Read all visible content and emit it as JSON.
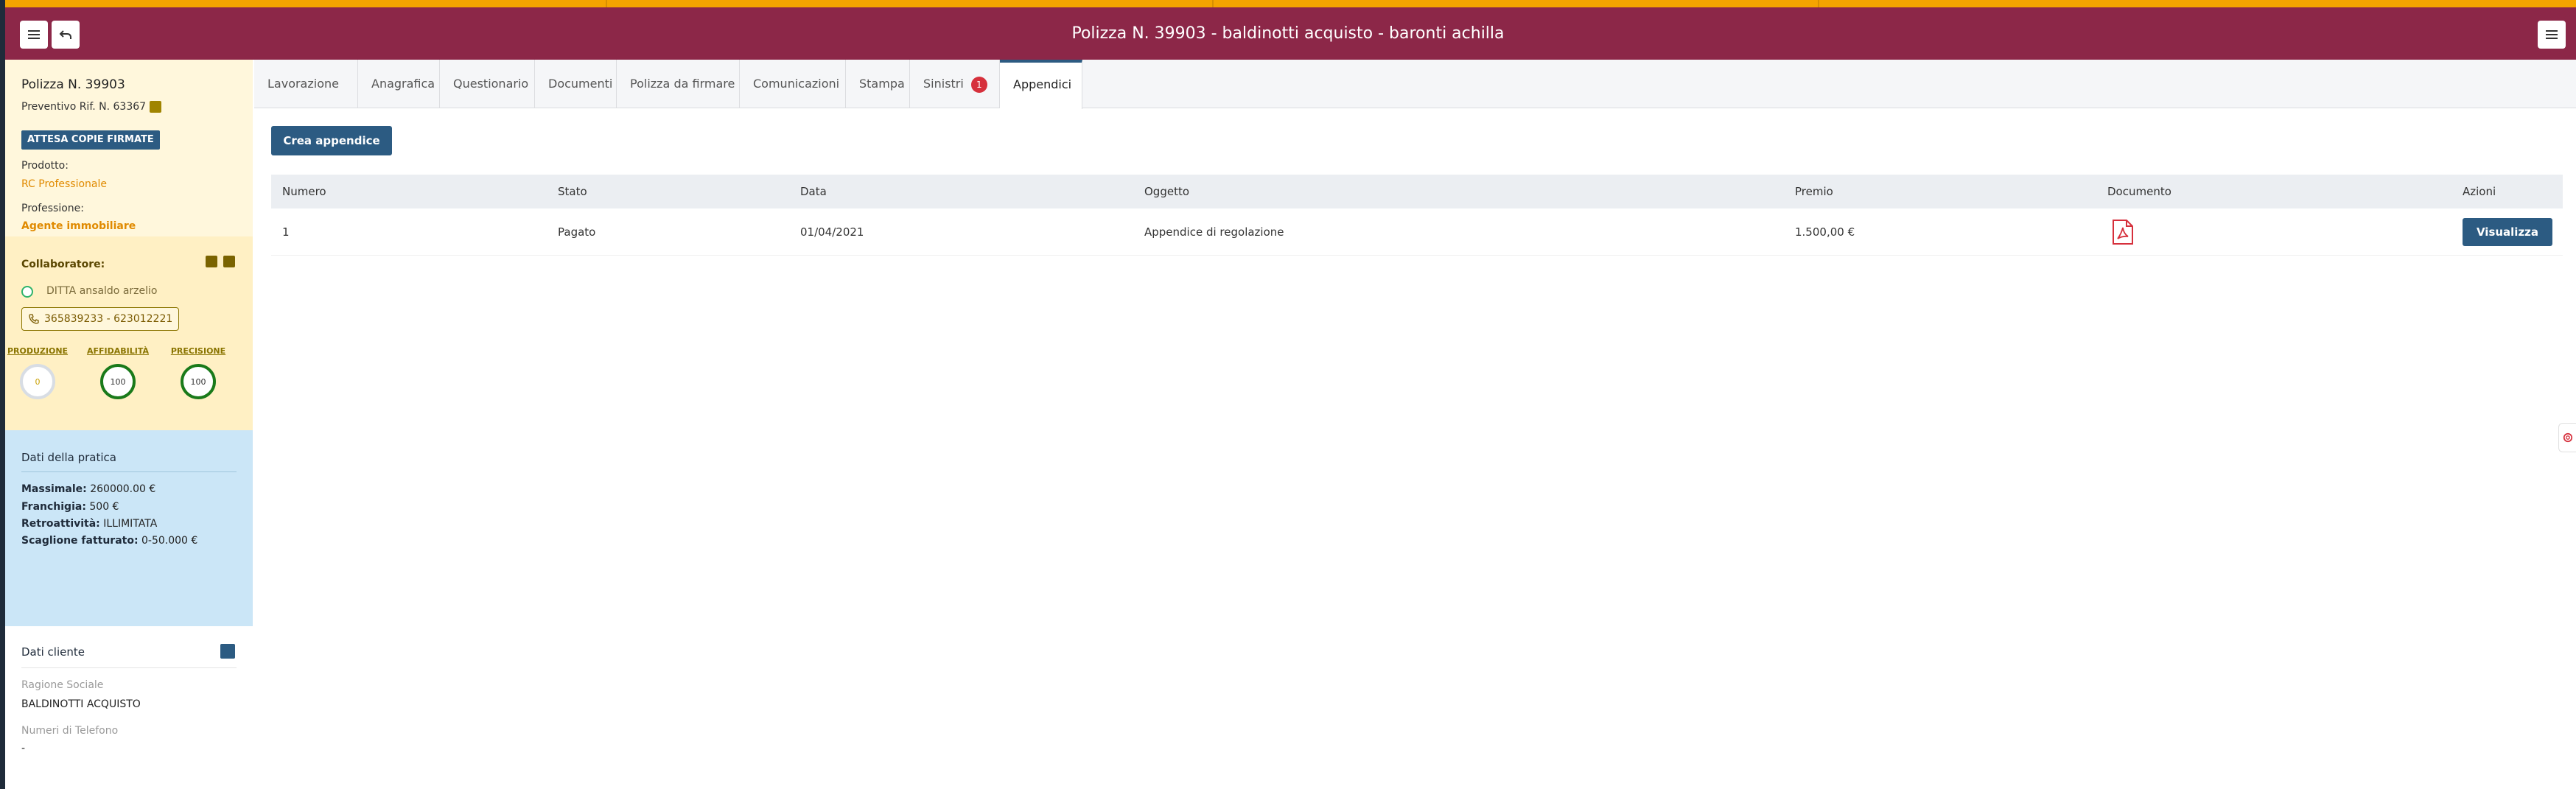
{
  "header": {
    "title": "Polizza N. 39903 - baldinotti acquisto - baronti achilla",
    "menu_icon": "hamburger-menu-icon",
    "back_icon": "undo-arrow-icon",
    "right_menu_icon": "hamburger-menu-icon"
  },
  "colors": {
    "header_bg": "#8c2748",
    "accent_orange": "#f5a400",
    "primary_button": "#2c5b82",
    "sidebar_policy_bg": "#fff7dc",
    "sidebar_collab_bg": "#fff0c4",
    "sidebar_pratica_bg": "#cbe6f7",
    "badge_red": "#d6303c"
  },
  "sidebar": {
    "policy": {
      "title": "Polizza N. 39903",
      "preventivo": "Preventivo Rif. N. 63367",
      "status_badge": "ATTESA COPIE FIRMATE",
      "prodotto_label": "Prodotto:",
      "prodotto_value": "RC Professionale",
      "professione_label": "Professione:",
      "professione_value": "Agente immobiliare"
    },
    "collaboratore": {
      "title": "Collaboratore:",
      "name": "DITTA ansaldo arzelio",
      "phone": "365839233 - 623012221",
      "metrics": [
        {
          "label": "PRODUZIONE",
          "value": "0"
        },
        {
          "label": "AFFIDABILITÀ",
          "value": "100"
        },
        {
          "label": "PRECISIONE",
          "value": "100"
        }
      ]
    },
    "pratica": {
      "title": "Dati della pratica",
      "massimale_label": "Massimale:",
      "massimale_value": "260000.00 €",
      "franchigia_label": "Franchigia:",
      "franchigia_value": "500 €",
      "retroattivita_label": "Retroattività:",
      "retroattivita_value": "ILLIMITATA",
      "scaglione_label": "Scaglione fatturato:",
      "scaglione_value": "0-50.000 €"
    },
    "cliente": {
      "title": "Dati cliente",
      "ragione_label": "Ragione Sociale",
      "ragione_value": "BALDINOTTI ACQUISTO",
      "telefono_label": "Numeri di Telefono",
      "telefono_value": "-"
    }
  },
  "tabs": [
    {
      "label": "Lavorazione"
    },
    {
      "label": "Anagrafica"
    },
    {
      "label": "Questionario"
    },
    {
      "label": "Documenti"
    },
    {
      "label": "Polizza da firmare"
    },
    {
      "label": "Comunicazioni"
    },
    {
      "label": "Stampa"
    },
    {
      "label": "Sinistri",
      "badge": "1"
    },
    {
      "label": "Appendici",
      "active": true
    }
  ],
  "main": {
    "create_button": "Crea appendice",
    "table": {
      "headers": [
        "Numero",
        "Stato",
        "Data",
        "Oggetto",
        "Premio",
        "Documento",
        "Azioni"
      ],
      "rows": [
        {
          "numero": "1",
          "stato": "Pagato",
          "data": "01/04/2021",
          "oggetto": "Appendice di regolazione",
          "premio": "1.500,00 €",
          "documento_icon": "pdf-file-icon",
          "azione": "Visualizza"
        }
      ]
    }
  }
}
